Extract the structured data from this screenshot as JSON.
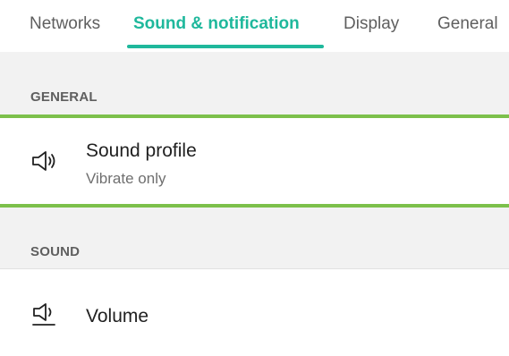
{
  "tabs": [
    {
      "label": "Networks",
      "active": false
    },
    {
      "label": "Sound & notification",
      "active": true
    },
    {
      "label": "Display",
      "active": false
    },
    {
      "label": "General",
      "active": false
    }
  ],
  "sections": {
    "general": {
      "header": "GENERAL",
      "items": [
        {
          "icon": "speaker-icon",
          "title": "Sound profile",
          "subtitle": "Vibrate only"
        }
      ]
    },
    "sound": {
      "header": "SOUND",
      "items": [
        {
          "icon": "volume-icon",
          "title": "Volume"
        }
      ]
    }
  },
  "colors": {
    "accent": "#1fb89c",
    "highlight": "#7cc04b",
    "section_background": "#f2f2f2"
  }
}
